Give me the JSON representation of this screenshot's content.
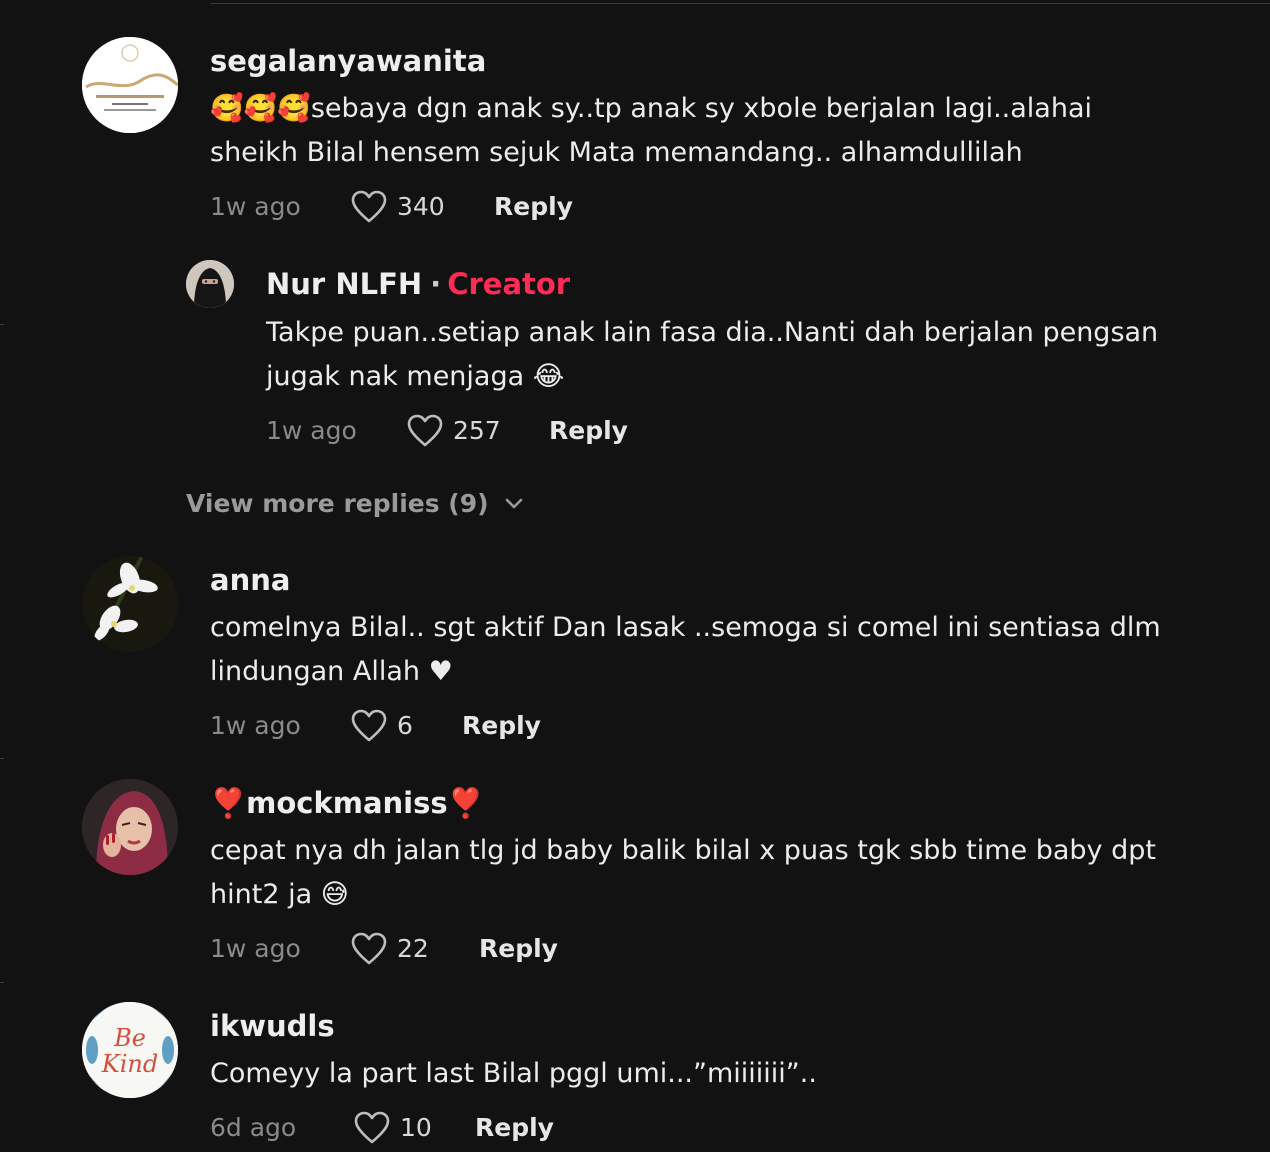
{
  "comments": [
    {
      "username": "segalanyawanita",
      "avatar": "segalanyawanita-logo-avatar",
      "line1": "🥰🥰🥰sebaya dgn anak sy..tp anak sy xbole berjalan lagi..alahai",
      "line2": "sheikh Bilal hensem sejuk Mata memandang.. alhamdullilah",
      "time": "1w ago",
      "likes": "340",
      "reply_label": "Reply"
    },
    {
      "username": "Nur NLFH",
      "creator_label": "Creator",
      "avatar": "niqab-avatar",
      "line1": "Takpe puan..setiap anak lain fasa dia..Nanti dah berjalan pengsan",
      "line2": "jugak nak menjaga 😂",
      "time": "1w ago",
      "likes": "257",
      "reply_label": "Reply"
    },
    {
      "username": "anna",
      "avatar": "white-flowers-avatar",
      "line1": "comelnya Bilal.. sgt aktif Dan lasak ..semoga si comel ini sentiasa dlm",
      "line2": "lindungan Allah ♥",
      "time": "1w ago",
      "likes": "6",
      "reply_label": "Reply"
    },
    {
      "username": "❣️mockmaniss❣️",
      "avatar": "woman-hijab-avatar",
      "line1": "cepat nya dh jalan tlg jd baby balik bilal x puas tgk sbb time baby dpt",
      "line2": "hint2 ja 😅",
      "time": "1w ago",
      "likes": "22",
      "reply_label": "Reply"
    },
    {
      "username": "ikwudls",
      "avatar": "be-kind-avatar",
      "line1": "Comeyy la part last Bilal pggl umi...”miiiiiii”..",
      "time": "6d ago",
      "likes": "10",
      "reply_label": "Reply"
    }
  ],
  "view_more_replies": "View more replies (9)",
  "colors": {
    "background": "#121212",
    "creator_accent": "#fe2c55",
    "secondary_text": "#8a8a8a"
  },
  "icons": {
    "like": "heart-outline-icon",
    "expand": "chevron-down-icon"
  }
}
